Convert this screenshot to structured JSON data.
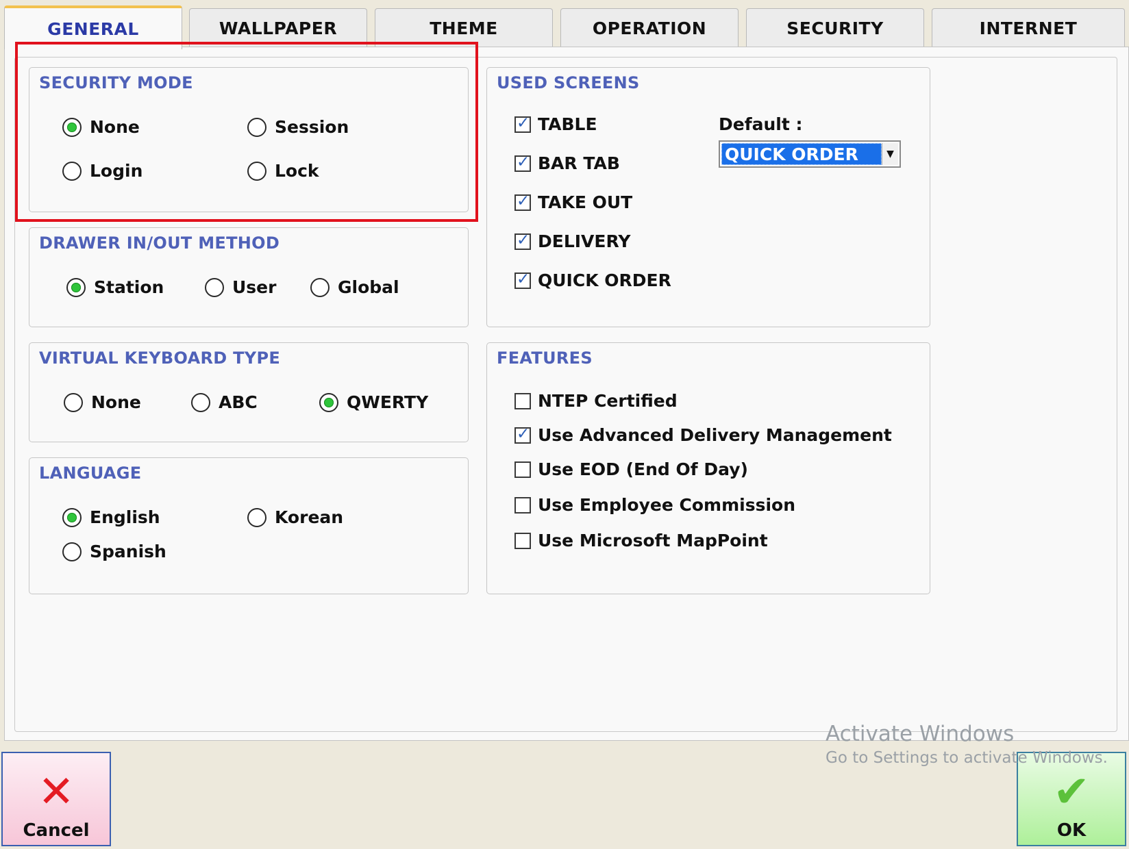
{
  "tabs": [
    {
      "label": "GENERAL",
      "active": true
    },
    {
      "label": "WALLPAPER",
      "active": false
    },
    {
      "label": "THEME",
      "active": false
    },
    {
      "label": "OPERATION",
      "active": false
    },
    {
      "label": "SECURITY",
      "active": false
    },
    {
      "label": "INTERNET",
      "active": false
    }
  ],
  "security_mode": {
    "title": "SECURITY MODE",
    "options": [
      {
        "label": "None",
        "selected": true
      },
      {
        "label": "Session",
        "selected": false
      },
      {
        "label": "Login",
        "selected": false
      },
      {
        "label": "Lock",
        "selected": false
      }
    ]
  },
  "drawer_method": {
    "title": "DRAWER IN/OUT METHOD",
    "options": [
      {
        "label": "Station",
        "selected": true
      },
      {
        "label": "User",
        "selected": false
      },
      {
        "label": "Global",
        "selected": false
      }
    ]
  },
  "keyboard_type": {
    "title": "VIRTUAL KEYBOARD TYPE",
    "options": [
      {
        "label": "None",
        "selected": false
      },
      {
        "label": "ABC",
        "selected": false
      },
      {
        "label": "QWERTY",
        "selected": true
      }
    ]
  },
  "language": {
    "title": "LANGUAGE",
    "options": [
      {
        "label": "English",
        "selected": true
      },
      {
        "label": "Korean",
        "selected": false
      },
      {
        "label": "Spanish",
        "selected": false
      }
    ]
  },
  "used_screens": {
    "title": "USED SCREENS",
    "items": [
      {
        "label": "TABLE",
        "checked": true
      },
      {
        "label": "BAR TAB",
        "checked": true
      },
      {
        "label": "TAKE OUT",
        "checked": true
      },
      {
        "label": "DELIVERY",
        "checked": true
      },
      {
        "label": "QUICK ORDER",
        "checked": true
      }
    ],
    "default_label": "Default :",
    "default_value": "QUICK ORDER"
  },
  "features": {
    "title": "FEATURES",
    "items": [
      {
        "label": "NTEP Certified",
        "checked": false
      },
      {
        "label": "Use Advanced Delivery Management",
        "checked": true
      },
      {
        "label": "Use EOD (End Of Day)",
        "checked": false
      },
      {
        "label": "Use Employee Commission",
        "checked": false
      },
      {
        "label": "Use Microsoft MapPoint",
        "checked": false
      }
    ]
  },
  "buttons": {
    "cancel_label": "Cancel",
    "ok_label": "OK"
  },
  "watermark": {
    "line1": "Activate Windows",
    "line2": "Go to Settings to activate Windows."
  },
  "colors": {
    "accent_title": "#4f61b8",
    "active_tab": "#2b3aa6",
    "highlight": "#e1121d",
    "radio_selected": "#2fc53b",
    "select_highlight": "#1a6fe8"
  }
}
